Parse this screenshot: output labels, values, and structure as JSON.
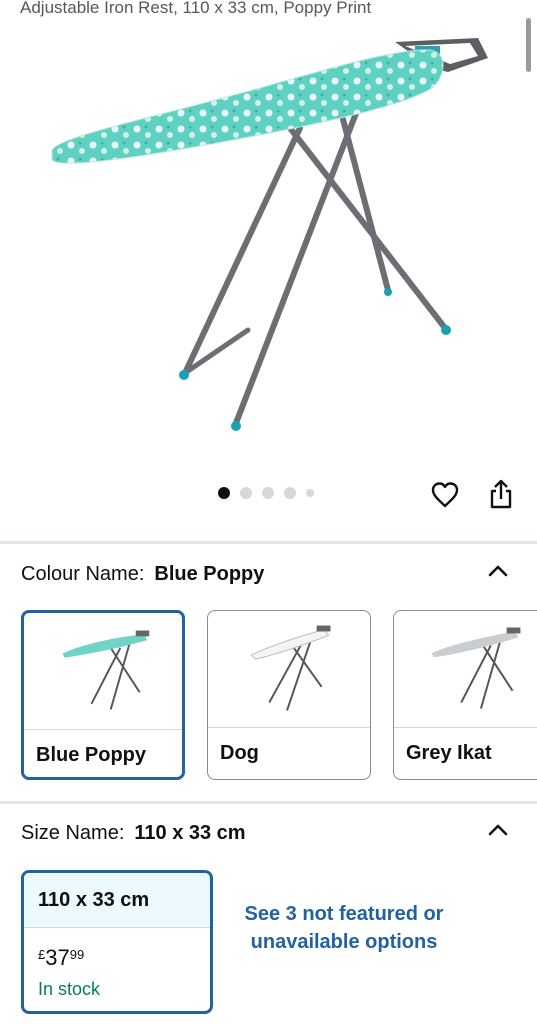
{
  "product": {
    "title_fragment": "Adjustable Iron Rest, 110 x 33 cm, Poppy Print",
    "image_count": 5,
    "image_index": 1
  },
  "icons": {
    "wishlist": "heart-icon",
    "share": "share-icon",
    "collapse": "chevron-up-icon"
  },
  "colour": {
    "label": "Colour Name:",
    "selected": "Blue Poppy",
    "options": [
      {
        "name": "Blue Poppy",
        "cover_color": "#6fd3c7"
      },
      {
        "name": "Dog",
        "cover_color": "#f4f4f4"
      },
      {
        "name": "Grey Ikat",
        "cover_color": "#c9ced3"
      }
    ]
  },
  "size": {
    "label": "Size Name:",
    "selected": "110 x 33 cm",
    "card": {
      "name": "110 x 33 cm",
      "currency": "£",
      "price_whole": "37",
      "price_fraction": "99",
      "availability": "In stock"
    },
    "more_options": "See 3 not featured or unavailable options"
  },
  "colors": {
    "accent_blue": "#2162a1",
    "stock_green": "#067d62",
    "selected_bg": "#edfafd"
  }
}
